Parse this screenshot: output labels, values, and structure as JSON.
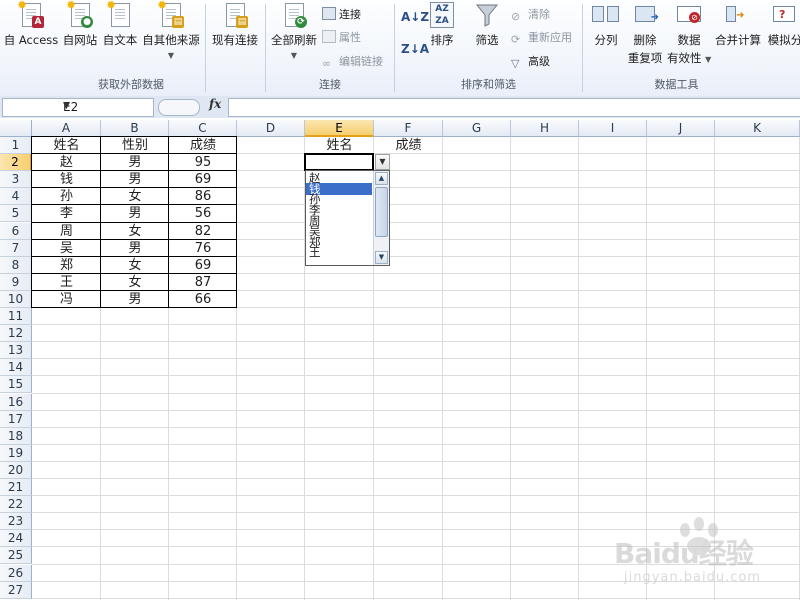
{
  "ribbon": {
    "groups": {
      "external": {
        "label": "获取外部数据",
        "buttons": [
          "自 Access",
          "自网站",
          "自文本",
          "自其他来源",
          "现有连接"
        ]
      },
      "connections": {
        "label": "连接",
        "refresh": "全部刷新",
        "connections": "连接",
        "properties": "属性",
        "edit_links": "编辑链接"
      },
      "sort_filter": {
        "label": "排序和筛选",
        "sort": "排序",
        "filter": "筛选",
        "clear": "清除",
        "reapply": "重新应用",
        "advanced": "高级"
      },
      "data_tools": {
        "label": "数据工具",
        "text_to_columns": "分列",
        "remove_dup_1": "删除",
        "remove_dup_2": "重复项",
        "validation_1": "数据",
        "validation_2": "有效性",
        "consolidate": "合并计算",
        "what_if": "模拟分"
      }
    },
    "icons": [
      "access-icon",
      "web-icon",
      "text-file-icon",
      "other-sources-icon",
      "existing-connections-icon",
      "refresh-all-icon",
      "connections-icon",
      "properties-icon",
      "edit-links-icon",
      "sort-asc-icon",
      "sort-desc-icon",
      "sort-icon",
      "filter-icon",
      "clear-icon",
      "reapply-icon",
      "advanced-icon",
      "text-to-columns-icon",
      "remove-duplicates-icon",
      "data-validation-icon",
      "consolidate-icon",
      "what-if-icon"
    ]
  },
  "formula_bar": {
    "name_box": "E2",
    "fx": "fx",
    "formula": ""
  },
  "sheet": {
    "columns": [
      "A",
      "B",
      "C",
      "D",
      "E",
      "F",
      "G",
      "H",
      "I",
      "J",
      "K"
    ],
    "selected_column": "E",
    "rows": [
      "1",
      "2",
      "3",
      "4",
      "5",
      "6",
      "7",
      "8",
      "9",
      "10",
      "11",
      "12",
      "13",
      "14",
      "15",
      "16",
      "17",
      "18",
      "19",
      "20",
      "21",
      "22",
      "23",
      "24",
      "25",
      "26",
      "27"
    ],
    "selected_row": "2",
    "table_headers": [
      "姓名",
      "性别",
      "成绩"
    ],
    "table_rows": [
      [
        "赵",
        "男",
        "95"
      ],
      [
        "钱",
        "男",
        "69"
      ],
      [
        "孙",
        "女",
        "86"
      ],
      [
        "李",
        "男",
        "56"
      ],
      [
        "周",
        "女",
        "82"
      ],
      [
        "吴",
        "男",
        "76"
      ],
      [
        "郑",
        "女",
        "69"
      ],
      [
        "王",
        "女",
        "87"
      ],
      [
        "冯",
        "男",
        "66"
      ]
    ],
    "lookup_headers": [
      "姓名",
      "成绩"
    ],
    "active_cell": "E2",
    "active_cell_value": ""
  },
  "dropdown": {
    "options": [
      "赵",
      "钱",
      "孙",
      "李",
      "周",
      "吴",
      "郑",
      "王"
    ],
    "highlighted": "钱"
  },
  "watermark": {
    "brand": "Baidu经验",
    "url": "jingyan.baidu.com"
  },
  "colors": {
    "selection_header": "#f7cf6f",
    "highlight": "#3b6ec9",
    "gridline": "#dadcdd"
  }
}
